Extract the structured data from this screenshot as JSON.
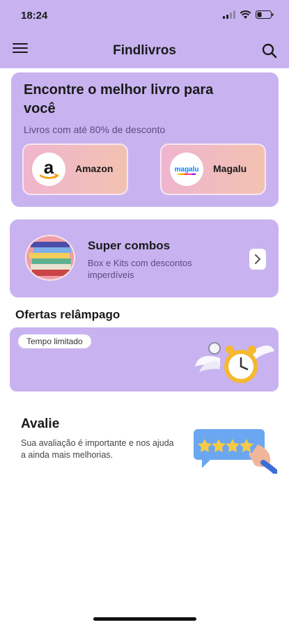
{
  "status_bar": {
    "time": "18:24"
  },
  "app_bar": {
    "title": "Findlivros",
    "menu_icon": "hamburger-menu-icon",
    "search_icon": "search-icon"
  },
  "hero": {
    "title": "Encontre o melhor livro para você",
    "subtitle": "Livros com até 80% de desconto",
    "stores": [
      {
        "name": "Amazon",
        "logo_text": "a"
      },
      {
        "name": "Magalu",
        "logo_text": "magalu"
      }
    ]
  },
  "combos": {
    "title": "Super combos",
    "description": "Box e Kits com descontos imperdíveis"
  },
  "flash_offers": {
    "section_title": "Ofertas relâmpago",
    "badge": "Tempo limitado"
  },
  "rating": {
    "title": "Avalie",
    "description": "Sua avaliação é importante e nos ajuda a ainda mais melhorias."
  },
  "colors": {
    "accent": "#c8b3f0",
    "store_gradient_start": "#efb5cf",
    "store_gradient_end": "#f2c2b0"
  }
}
